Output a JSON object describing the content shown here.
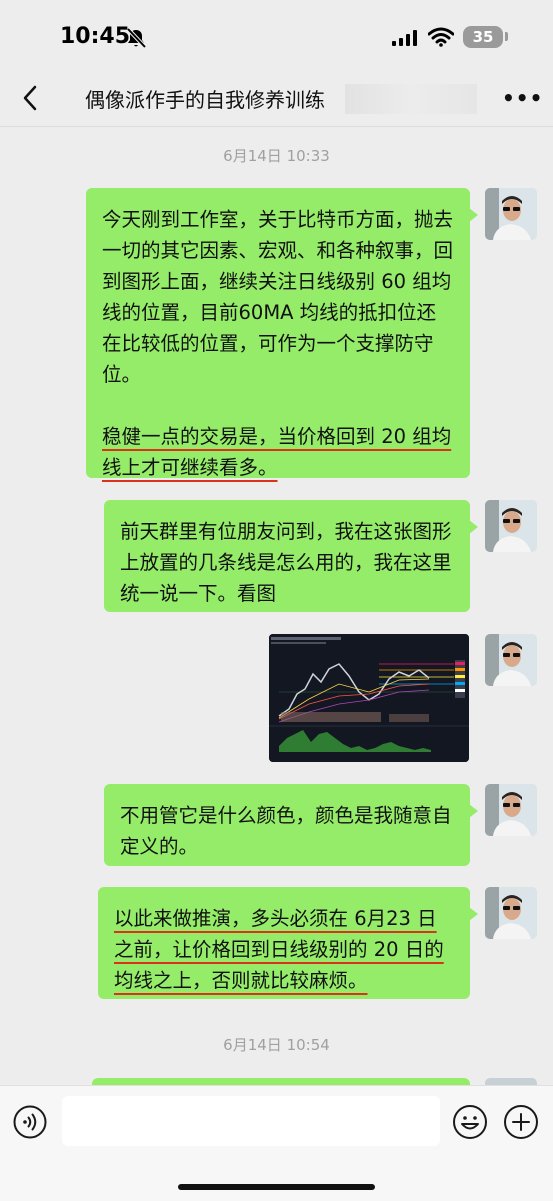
{
  "status_bar": {
    "time": "10:45",
    "battery": "35"
  },
  "header": {
    "title": "偶像派作手的自我修养训练"
  },
  "messages": {
    "ts1": "6月14日 10:33",
    "m1": {
      "p1": "今天刚到工作室，关于比特币方面，抛去一切的其它因素、宏观、和各种叙事，回到图形上面，继续关注日线级别 60 组均线的位置，目前60MA 均线的抵扣位还在比较低的位置，可作为一个支撑防守位。",
      "p2": "稳健一点的交易是，当价格回到 20 组均线上才可继续看多。"
    },
    "m2": "前天群里有位朋友问到，我在这张图形上放置的几条线是怎么用的，我在这里统一说一下。看图",
    "m4": "不用管它是什么颜色，颜色是我随意自定义的。",
    "m5": "以此来做推演，多头必须在 6月23 日之前，让价格回到日线级别的 20 日的均线之上，否则就比较麻烦。",
    "ts2": "6月14日 10:54"
  },
  "colors": {
    "bubble": "#95ec69",
    "background": "#ededed",
    "underline": "#d9341b"
  },
  "icons": [
    "bell-slash-icon",
    "signal-icon",
    "wifi-icon",
    "back-icon",
    "more-icon",
    "voice-icon",
    "emoji-icon",
    "plus-icon"
  ]
}
